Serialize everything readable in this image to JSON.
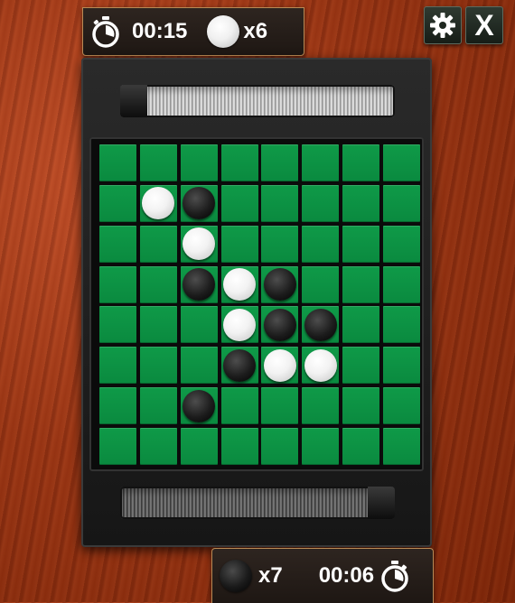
{
  "top_hud": {
    "timer": "00:15",
    "piece_color": "white",
    "count": "x6"
  },
  "bottom_hud": {
    "timer": "00:06",
    "piece_color": "black",
    "count": "x7"
  },
  "controls": {
    "settings_icon": "gear-icon",
    "close_label": "X"
  },
  "board": {
    "size": 8,
    "rows": [
      [
        "",
        "",
        "",
        "",
        "",
        "",
        "",
        ""
      ],
      [
        "",
        "W",
        "B",
        "",
        "",
        "",
        "",
        ""
      ],
      [
        "",
        "",
        "W",
        "",
        "",
        "",
        "",
        ""
      ],
      [
        "",
        "",
        "B",
        "W",
        "B",
        "",
        "",
        ""
      ],
      [
        "",
        "",
        "",
        "W",
        "B",
        "B",
        "",
        ""
      ],
      [
        "",
        "",
        "",
        "B",
        "W",
        "W",
        "",
        ""
      ],
      [
        "",
        "",
        "B",
        "",
        "",
        "",
        "",
        ""
      ],
      [
        "",
        "",
        "",
        "",
        "",
        "",
        "",
        ""
      ]
    ]
  },
  "colors": {
    "board_green": "#0a8a3f",
    "wood": "#9a3615",
    "frame": "#1a1a1a"
  }
}
